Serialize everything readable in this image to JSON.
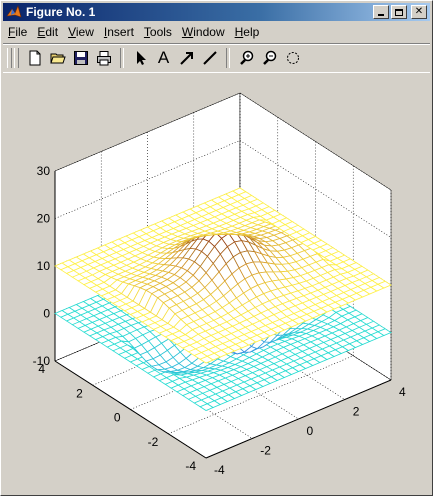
{
  "window": {
    "title": "Figure No. 1"
  },
  "menu": [
    {
      "pre": "",
      "u": "F",
      "post": "ile"
    },
    {
      "pre": "",
      "u": "E",
      "post": "dit"
    },
    {
      "pre": "",
      "u": "V",
      "post": "iew"
    },
    {
      "pre": "",
      "u": "I",
      "post": "nsert"
    },
    {
      "pre": "",
      "u": "T",
      "post": "ools"
    },
    {
      "pre": "",
      "u": "W",
      "post": "indow"
    },
    {
      "pre": "",
      "u": "H",
      "post": "elp"
    }
  ],
  "toolbar": {
    "text_tool_label": "A",
    "icons": [
      "new-file-icon",
      "open-folder-icon",
      "save-icon",
      "print-icon",
      "arrow-select-icon",
      "text-icon",
      "arrow-icon",
      "line-icon",
      "zoom-in-icon",
      "zoom-out-icon",
      "rotate-icon"
    ]
  },
  "colors": {
    "titlebar_start": "#0a246a",
    "window_bg": "#d4d0c8",
    "axes_bg": "#ffffff",
    "upper_surface": "#f5a020",
    "lower_surface": "#1a7fe8"
  },
  "chart_data": {
    "type": "surface",
    "title": "",
    "xlabel": "",
    "ylabel": "",
    "zlabel": "",
    "xlim": [
      -4,
      4
    ],
    "ylim": [
      -4,
      4
    ],
    "zlim": [
      -10,
      30
    ],
    "x_ticks": [
      "-4",
      "-2",
      "0",
      "2",
      "4"
    ],
    "y_ticks": [
      "-4",
      "-2",
      "0",
      "2",
      "4"
    ],
    "z_ticks": [
      "-10",
      "0",
      "10",
      "20",
      "30"
    ],
    "grid": true,
    "series": [
      {
        "style": "mesh",
        "colormap": "hot",
        "base_level": 10,
        "peak": 20
      },
      {
        "style": "mesh",
        "colormap": "cool",
        "base_level": 0,
        "trough": -10
      }
    ]
  }
}
